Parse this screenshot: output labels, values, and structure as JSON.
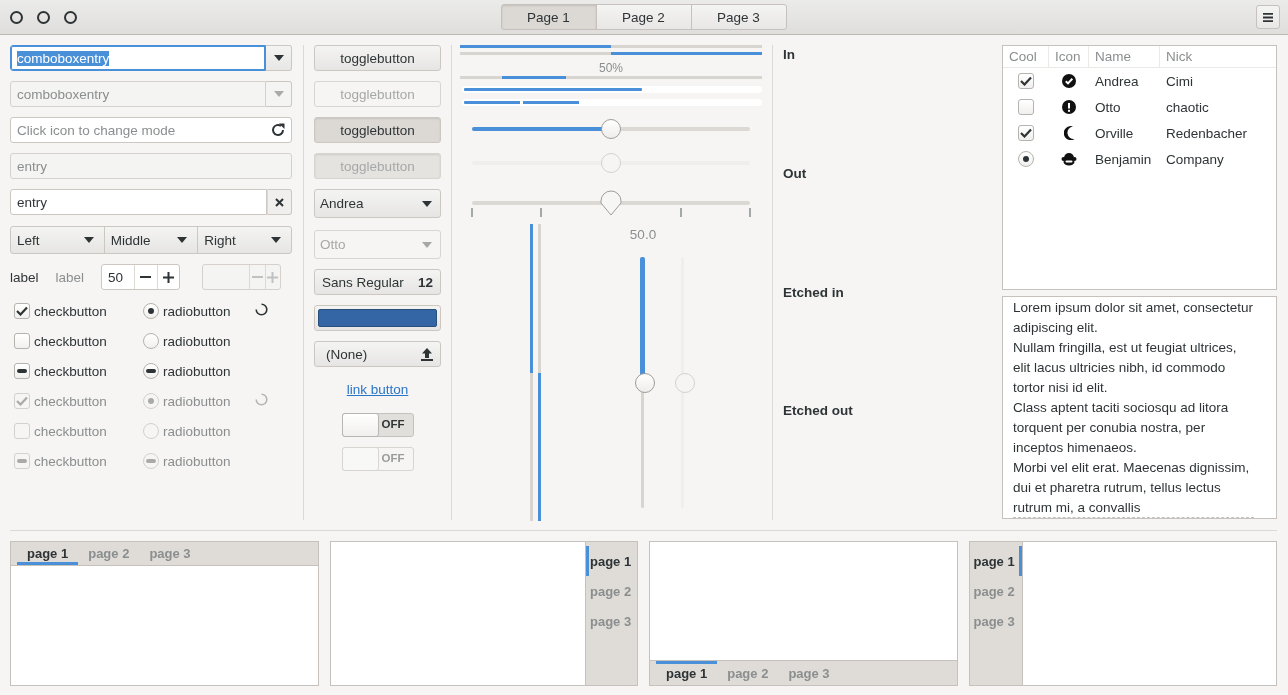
{
  "header_tabs": [
    {
      "label": "Page 1",
      "selected": true
    },
    {
      "label": "Page 2",
      "selected": false
    },
    {
      "label": "Page 3",
      "selected": false
    }
  ],
  "combo_entries": [
    {
      "value": "comboboxentry",
      "focused": true,
      "disabled": false
    },
    {
      "value": "comboboxentry",
      "focused": false,
      "disabled": true
    }
  ],
  "mode_entry": {
    "placeholder": "Click icon to change mode"
  },
  "entries": [
    {
      "value": "entry",
      "disabled": true,
      "clear_icon": false
    },
    {
      "value": "entry",
      "disabled": false,
      "clear_icon": true
    }
  ],
  "combo_group": [
    "Left",
    "Middle",
    "Right"
  ],
  "labels": [
    {
      "text": "label",
      "disabled": false
    },
    {
      "text": "label",
      "disabled": true
    }
  ],
  "spin_buttons": [
    {
      "value": "50",
      "disabled": false
    },
    {
      "disabled": true
    }
  ],
  "check_rows": [
    {
      "check": {
        "label": "checkbutton",
        "checked": true
      },
      "radio": {
        "label": "radiobutton",
        "checked": true
      },
      "disabled": false,
      "spinner": true
    },
    {
      "check": {
        "label": "checkbutton",
        "checked": false
      },
      "radio": {
        "label": "radiobutton",
        "checked": false
      },
      "disabled": false,
      "spinner": false
    },
    {
      "check": {
        "label": "checkbutton",
        "inconsistent": true
      },
      "radio": {
        "label": "radiobutton",
        "inconsistent": true
      },
      "disabled": false,
      "spinner": false
    },
    {
      "check": {
        "label": "checkbutton",
        "checked": true
      },
      "radio": {
        "label": "radiobutton",
        "checked": true
      },
      "disabled": true,
      "spinner": true
    },
    {
      "check": {
        "label": "checkbutton",
        "checked": false
      },
      "radio": {
        "label": "radiobutton",
        "checked": false
      },
      "disabled": true,
      "spinner": false
    },
    {
      "check": {
        "label": "checkbutton",
        "inconsistent": true
      },
      "radio": {
        "label": "radiobutton",
        "inconsistent": true
      },
      "disabled": true,
      "spinner": false
    }
  ],
  "toggle_buttons": [
    {
      "label": "togglebutton",
      "active": false,
      "disabled": false
    },
    {
      "label": "togglebutton",
      "active": false,
      "disabled": true
    },
    {
      "label": "togglebutton",
      "active": true,
      "disabled": false
    },
    {
      "label": "togglebutton",
      "active": true,
      "disabled": true
    }
  ],
  "combos": [
    {
      "value": "Andrea",
      "disabled": false
    },
    {
      "value": "Otto",
      "disabled": true
    }
  ],
  "font_button": {
    "family": "Sans Regular",
    "size": "12"
  },
  "file_button": {
    "label": "(None)"
  },
  "link_button": {
    "label": "link button"
  },
  "switches": [
    {
      "label": "OFF",
      "on": false,
      "disabled": false
    },
    {
      "label": "OFF",
      "on": false,
      "disabled": true
    }
  ],
  "progress_bars": [
    {
      "level": 0.5,
      "inverted": false
    },
    {
      "level": 0.5,
      "inverted": true
    }
  ],
  "activity_bar": {
    "text": "50%"
  },
  "level_bars": [
    {
      "kind": "continuous",
      "level": 0.6
    },
    {
      "kind": "discrete",
      "level": 0.4
    }
  ],
  "scales": [
    {
      "kind": "filled",
      "level": 0.5,
      "disabled": false
    },
    {
      "kind": "filled",
      "level": 0.5,
      "disabled": true
    },
    {
      "kind": "marks",
      "level": 0.5,
      "disabled": false
    }
  ],
  "vertical_progress": [
    {
      "level": 0.5,
      "inverted": false
    },
    {
      "level": 0.5,
      "inverted": true
    }
  ],
  "vertical_scales": [
    {
      "value": "50.0",
      "level": 0.5,
      "disabled": false
    },
    {
      "level": 0.5,
      "disabled": true
    }
  ],
  "frames": [
    "In",
    "Out",
    "Etched in",
    "Etched out"
  ],
  "tree": {
    "columns": [
      "Cool",
      "Icon",
      "Name",
      "Nick"
    ],
    "rows": [
      {
        "cool": {
          "kind": "check",
          "checked": true
        },
        "icon": {
          "kind": "check"
        },
        "name": "Andrea",
        "nick": "Cimi"
      },
      {
        "cool": {
          "kind": "check",
          "checked": false
        },
        "icon": {
          "kind": "alert"
        },
        "name": "Otto",
        "nick": "chaotic"
      },
      {
        "cool": {
          "kind": "check",
          "checked": true
        },
        "icon": {
          "kind": "moon"
        },
        "name": "Orville",
        "nick": "Redenbacher"
      },
      {
        "cool": {
          "kind": "radio",
          "checked": true
        },
        "icon": {
          "kind": "creature"
        },
        "name": "Benjamin",
        "nick": "Company"
      }
    ]
  },
  "text_view": [
    "Lorem ipsum dolor sit amet, consectetur adipiscing elit.",
    "Nullam fringilla, est ut feugiat ultrices, elit lacus ultricies nibh, id commodo tortor nisi id elit.",
    "Class aptent taciti sociosqu ad litora torquent per conubia nostra, per inceptos himenaeos.",
    "Morbi vel elit erat. Maecenas dignissim, dui et pharetra rutrum, tellus lectus rutrum mi, a convallis"
  ],
  "notebooks": [
    {
      "kind": "top",
      "tabs": [
        {
          "label": "page 1",
          "selected": true
        },
        {
          "label": "page 2",
          "selected": false
        },
        {
          "label": "page 3",
          "selected": false
        }
      ]
    },
    {
      "kind": "right",
      "tabs": [
        {
          "label": "page 1",
          "selected": true
        },
        {
          "label": "page 2",
          "selected": false
        },
        {
          "label": "page 3",
          "selected": false
        }
      ]
    },
    {
      "kind": "bottom",
      "tabs": [
        {
          "label": "page 1",
          "selected": true
        },
        {
          "label": "page 2",
          "selected": false
        },
        {
          "label": "page 3",
          "selected": false
        }
      ]
    },
    {
      "kind": "left",
      "tabs": [
        {
          "label": "page 1",
          "selected": true
        },
        {
          "label": "page 2",
          "selected": false
        },
        {
          "label": "page 3",
          "selected": false
        }
      ]
    }
  ]
}
